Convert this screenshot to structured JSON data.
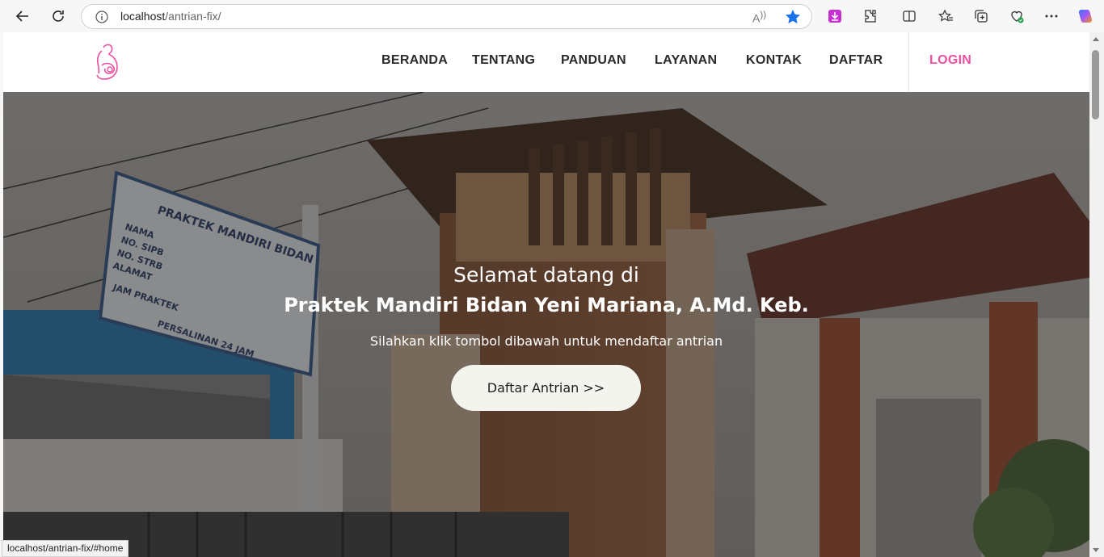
{
  "browser": {
    "url_host": "localhost",
    "url_path": "/antrian-fix/",
    "read_aloud_label": "A",
    "status_url": "localhost/antrian-fix/#home",
    "icons": [
      "back-arrow-icon",
      "refresh-icon",
      "info-icon",
      "read-aloud-icon",
      "favorite-star-icon",
      "download-extension-icon",
      "extensions-icon",
      "split-screen-icon",
      "favorites-icon",
      "collections-icon",
      "performance-icon",
      "more-icon",
      "copilot-icon"
    ],
    "accent": "#1a73e8"
  },
  "navbar": {
    "items": [
      {
        "label": "BERANDA"
      },
      {
        "label": "TENTANG"
      },
      {
        "label": "PANDUAN"
      },
      {
        "label": "LAYANAN"
      },
      {
        "label": "KONTAK"
      },
      {
        "label": "DAFTAR"
      }
    ],
    "login_label": "LOGIN",
    "logo_icon": "mother-baby-logo-icon",
    "accent_color": "#ec4fa0"
  },
  "hero": {
    "welcome": "Selamat datang di",
    "title": "Praktek Mandiri Bidan Yeni Mariana, A.Md. Keb.",
    "subtitle": "Silahkan klik tombol dibawah untuk mendaftar antrian",
    "cta_label": "Daftar Antrian >>",
    "sign_lines": [
      "PRAKTEK MANDIRI BIDAN",
      "NAMA",
      "NO. SIPB",
      "NO. STRB",
      "ALAMAT",
      "JAM PRAKTEK",
      "PERSALINAN 24 JAM"
    ]
  }
}
